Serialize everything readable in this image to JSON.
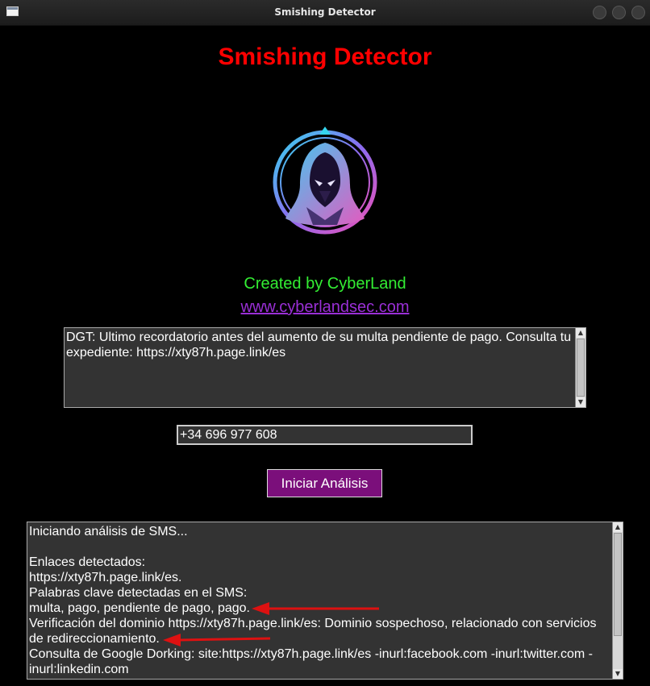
{
  "window": {
    "title": "Smishing Detector"
  },
  "header": {
    "title": "Smishing Detector"
  },
  "credits": {
    "created_by": "Created by CyberLand",
    "website": "www.cyberlandsec.com"
  },
  "sms_input": {
    "value": "DGT: Ultimo recordatorio antes del aumento de su multa pendiente de pago. Consulta tu expediente: https://xty87h.page.link/es"
  },
  "phone_input": {
    "value": "+34 696 977 608"
  },
  "analyze_button": {
    "label": "Iniciar Análisis"
  },
  "results": {
    "lines": [
      "Iniciando análisis de SMS...",
      "",
      "Enlaces detectados:",
      "https://xty87h.page.link/es.",
      "Palabras clave detectadas en el SMS:",
      "multa, pago, pendiente de pago, pago.",
      "Verificación del dominio https://xty87h.page.link/es: Dominio sospechoso, relacionado con servicios de redireccionamiento.",
      "Consulta de Google Dorking: site:https://xty87h.page.link/es -inurl:facebook.com -inurl:twitter.com -inurl:linkedin.com"
    ]
  },
  "colors": {
    "title": "#ff0000",
    "created_by": "#33ee33",
    "link": "#9a2fd6",
    "button": "#7b0f7b",
    "annotation_arrow": "#dd1111"
  }
}
